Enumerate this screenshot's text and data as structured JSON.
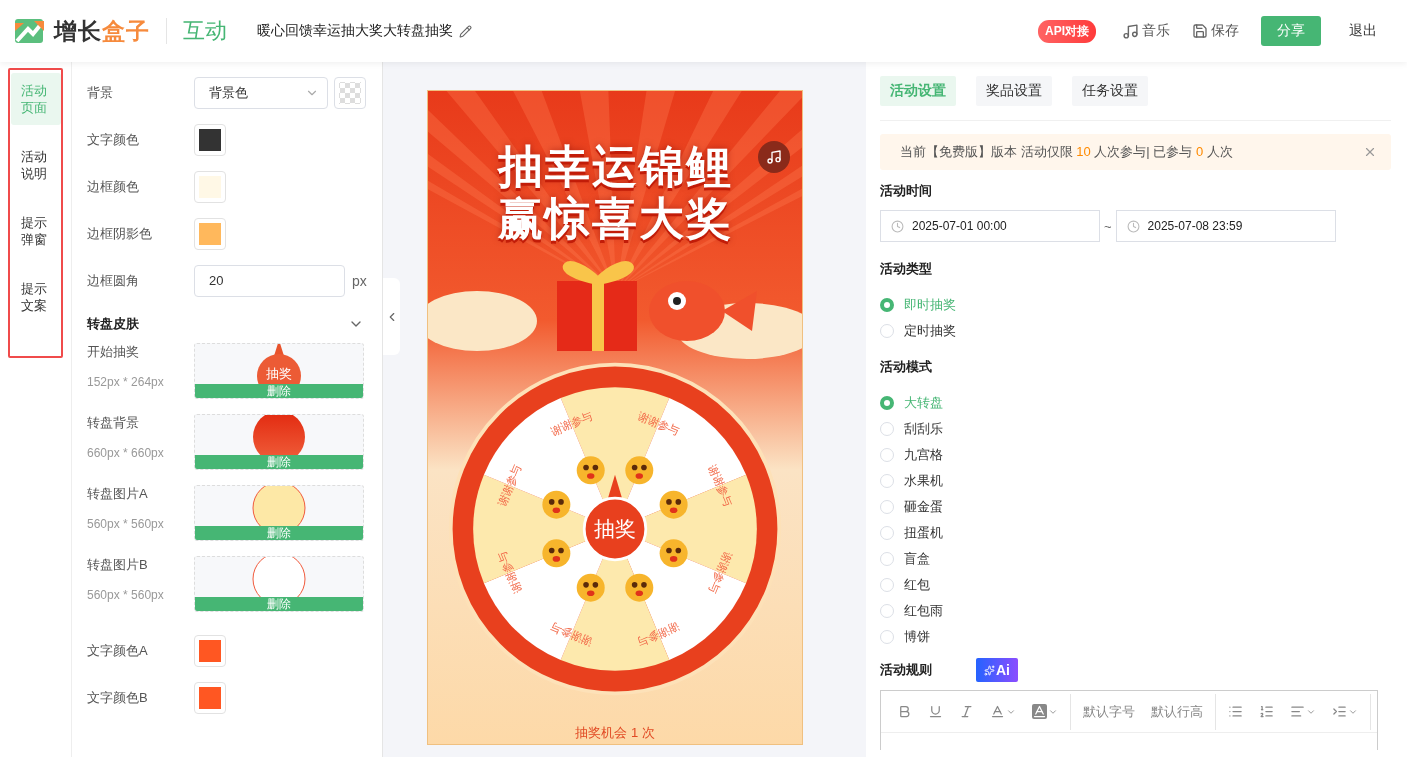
{
  "header": {
    "logo": {
      "part_1": "增长",
      "part_2": "盒子"
    },
    "module": "互动",
    "title": "暖心回馈幸运抽大奖大转盘抽奖",
    "badge": "API对接",
    "actions": [
      {
        "kind": "music",
        "label": "音乐"
      },
      {
        "kind": "save",
        "label": "保存"
      }
    ],
    "buttons": [
      {
        "kind": "primary",
        "label": "分享"
      },
      {
        "kind": "plain",
        "label": "退出"
      }
    ]
  },
  "side_nav": [
    {
      "label": "活动页面",
      "selected": true
    },
    {
      "label": "活动说明",
      "selected": false
    },
    {
      "label": "提示弹窗",
      "selected": false
    },
    {
      "label": "提示文案",
      "selected": false
    }
  ],
  "settings": [
    {
      "kind": "select",
      "label": "背景",
      "value": "背景色"
    },
    {
      "kind": "color",
      "label": "文字颜色",
      "color": "#333333"
    },
    {
      "kind": "color",
      "label": "边框颜色",
      "color": "#fff8e6"
    },
    {
      "kind": "color",
      "label": "边框阴影色",
      "color": "#ffb85c"
    },
    {
      "kind": "number",
      "label": "边框圆角",
      "value": "20",
      "unit": "px"
    },
    {
      "kind": "section",
      "label": "转盘皮肤",
      "expanded": true
    },
    {
      "kind": "image",
      "label": "开始抽奖",
      "size": "152px * 264px",
      "action": "删除",
      "thumb": {
        "kind": "pointer",
        "text": "抽奖"
      }
    },
    {
      "kind": "image",
      "label": "转盘背景",
      "size": "660px * 660px",
      "action": "删除",
      "thumb": {
        "kind": "disc"
      }
    },
    {
      "kind": "image",
      "label": "转盘图片A",
      "size": "560px * 560px",
      "action": "删除",
      "thumb": {
        "kind": "disc_a"
      }
    },
    {
      "kind": "image",
      "label": "转盘图片B",
      "size": "560px * 560px",
      "action": "删除",
      "thumb": {
        "kind": "disc_b"
      }
    },
    {
      "kind": "color",
      "label": "文字颜色A",
      "color": "#ff5722"
    },
    {
      "kind": "color",
      "label": "文字颜色B",
      "color": "#ff5722"
    }
  ],
  "preview": {
    "headline": [
      "抽幸运锦鲤",
      "赢惊喜大奖"
    ],
    "prizes": [
      "谢谢参与",
      "谢谢参与",
      "谢谢参与",
      "谢谢参与",
      "谢谢参与",
      "谢谢参与",
      "谢谢参与",
      "谢谢参与"
    ],
    "spin_button": "抽奖",
    "chances": "抽奖机会 1 次"
  },
  "right": {
    "tabs": [
      {
        "label": "活动设置",
        "selected": true
      },
      {
        "label": "奖品设置",
        "selected": false
      },
      {
        "label": "任务设置",
        "selected": false
      }
    ],
    "notice": [
      {
        "text": "当前【免费版】版本 活动仅限 ",
        "highlight": false
      },
      {
        "text": "10",
        "highlight": true
      },
      {
        "text": " 人次参与| 已参与 ",
        "highlight": false
      },
      {
        "text": "0",
        "highlight": true
      },
      {
        "text": " 人次",
        "highlight": false
      }
    ],
    "time": {
      "label": "活动时间",
      "start": "2025-07-01 00:00",
      "separator": "~",
      "end": "2025-07-08 23:59"
    },
    "type": {
      "label": "活动类型",
      "options": [
        {
          "label": "即时抽奖",
          "selected": true
        },
        {
          "label": "定时抽奖",
          "selected": false
        }
      ]
    },
    "mode": {
      "label": "活动模式",
      "options": [
        {
          "label": "大转盘",
          "selected": true
        },
        {
          "label": "刮刮乐",
          "selected": false
        },
        {
          "label": "九宫格",
          "selected": false
        },
        {
          "label": "水果机",
          "selected": false
        },
        {
          "label": "砸金蛋",
          "selected": false
        },
        {
          "label": "扭蛋机",
          "selected": false
        },
        {
          "label": "盲盒",
          "selected": false
        },
        {
          "label": "红包",
          "selected": false
        },
        {
          "label": "红包雨",
          "selected": false
        },
        {
          "label": "博饼",
          "selected": false
        }
      ]
    },
    "rules": {
      "label": "活动规则",
      "ai": "Ai",
      "toolbar": [
        {
          "kind": "bold"
        },
        {
          "kind": "underline"
        },
        {
          "kind": "italic"
        },
        {
          "kind": "font_color"
        },
        {
          "kind": "bg_color"
        },
        {
          "kind": "divider"
        },
        {
          "kind": "select",
          "label": "默认字号"
        },
        {
          "kind": "select",
          "label": "默认行高"
        },
        {
          "kind": "divider"
        },
        {
          "kind": "bullets"
        },
        {
          "kind": "numbers"
        },
        {
          "kind": "align"
        },
        {
          "kind": "indent"
        },
        {
          "kind": "divider"
        }
      ]
    }
  }
}
